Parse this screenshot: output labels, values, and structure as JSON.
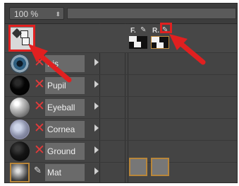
{
  "toolbar": {
    "zoom_value": "100 %",
    "stepper_icon": "updown-chevron-icon"
  },
  "columns": [
    {
      "label": "F.",
      "icon": "pencil-icon"
    },
    {
      "label": "R.",
      "icon": "pencil-icon"
    }
  ],
  "materials": [
    {
      "name": "Iris",
      "thumb": "iris-sphere",
      "status": "not-used"
    },
    {
      "name": "Pupil",
      "thumb": "black-sphere",
      "status": "not-used"
    },
    {
      "name": "Eyeball",
      "thumb": "gray-sphere",
      "status": "not-used"
    },
    {
      "name": "Cornea",
      "thumb": "glass-sphere",
      "status": "not-used"
    },
    {
      "name": "Ground",
      "thumb": "dark-sphere",
      "status": "not-used"
    },
    {
      "name": "Mat",
      "thumb": "selected-sphere",
      "status": "edit"
    }
  ],
  "colors": {
    "highlight": "#e02020",
    "selected_border": "#b8863a",
    "panel": "#444444"
  }
}
